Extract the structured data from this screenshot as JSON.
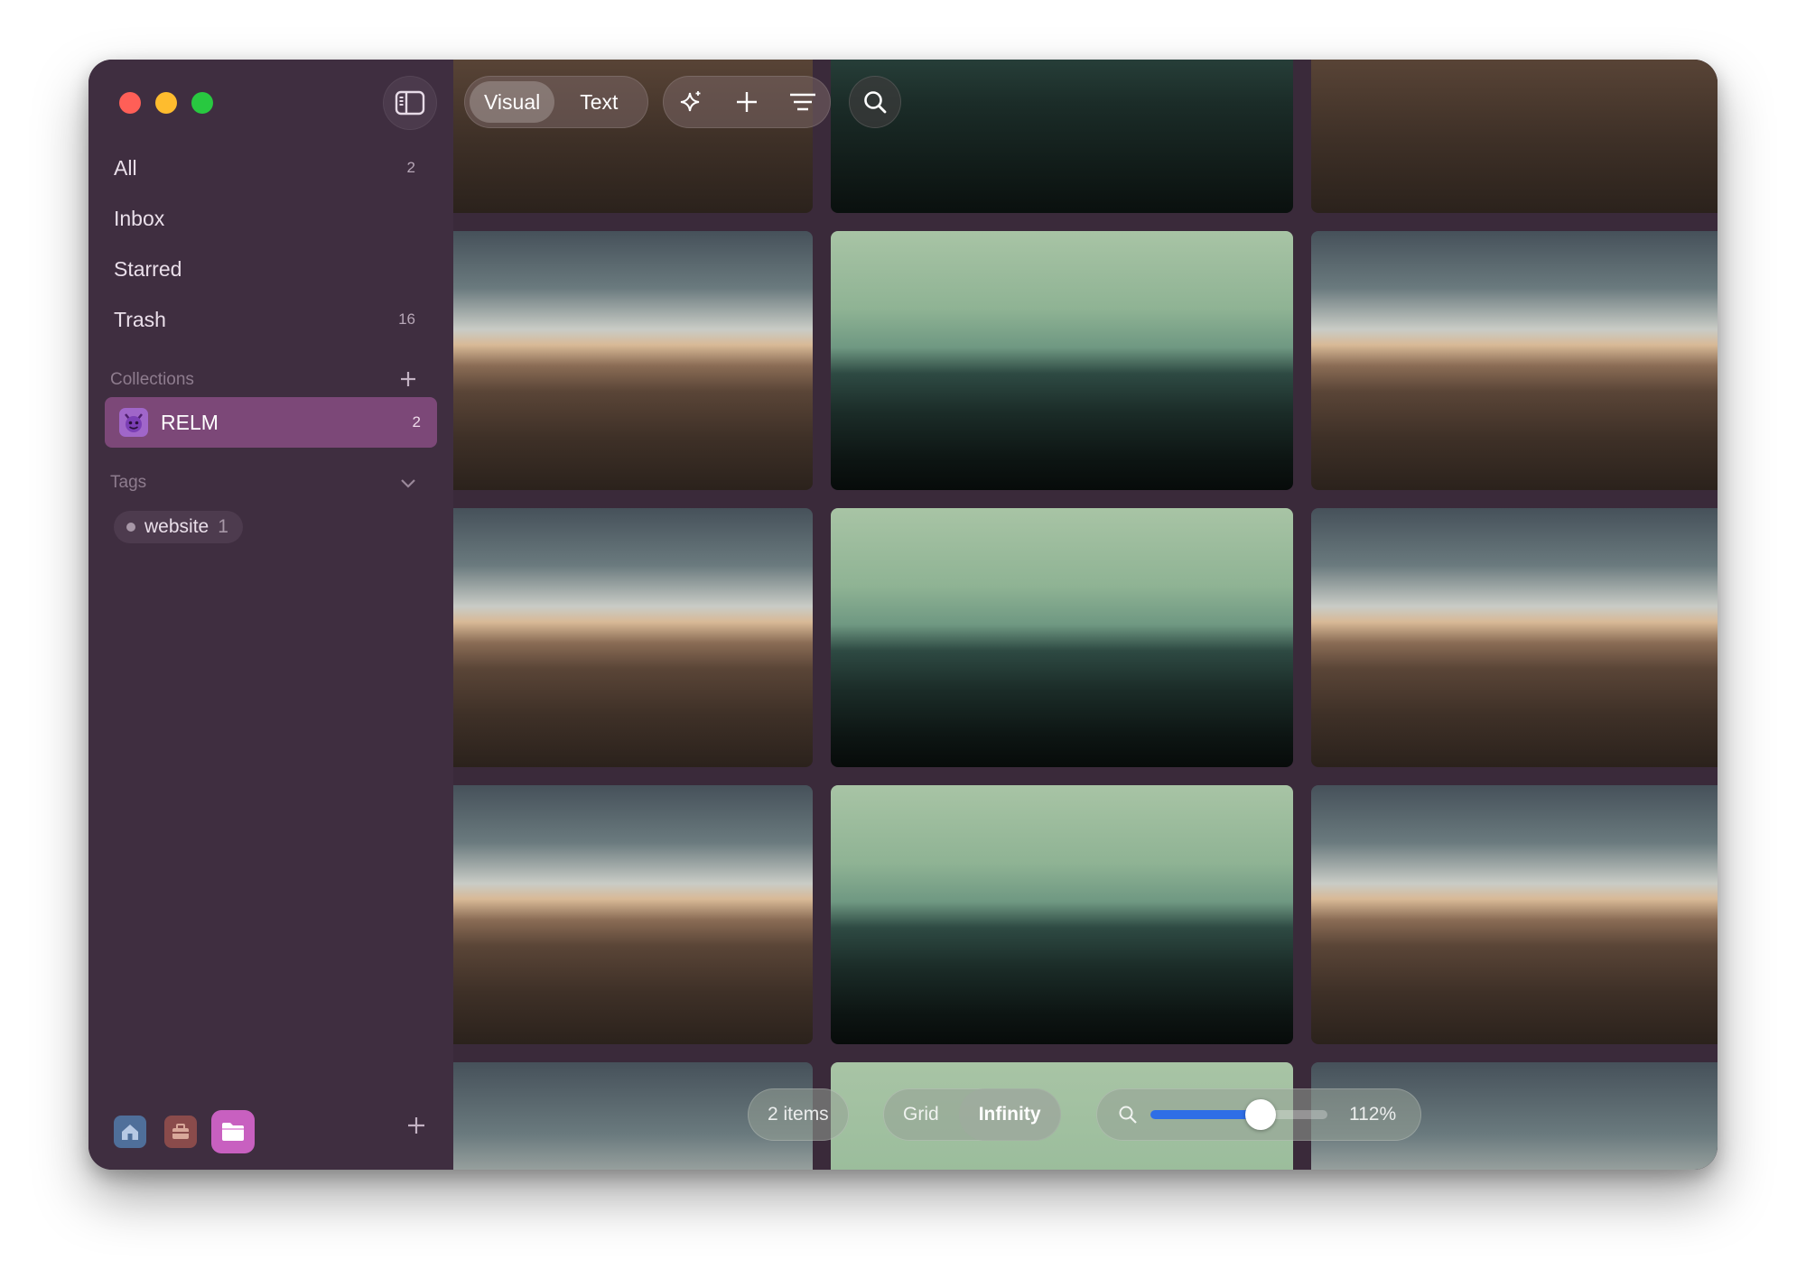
{
  "toolbar": {
    "view_modes": [
      "Visual",
      "Text"
    ],
    "active_view_mode": "Visual",
    "icons": [
      "sparkles-icon",
      "plus-icon",
      "filter-icon",
      "search-icon"
    ]
  },
  "sidebar": {
    "nav": [
      {
        "label": "All",
        "count": "2"
      },
      {
        "label": "Inbox",
        "count": ""
      },
      {
        "label": "Starred",
        "count": ""
      },
      {
        "label": "Trash",
        "count": "16"
      }
    ],
    "collections": {
      "label": "Collections",
      "items": [
        {
          "label": "RELM",
          "count": "2",
          "icon": "devil-emoji-icon",
          "selected": true
        }
      ]
    },
    "tags": {
      "label": "Tags",
      "items": [
        {
          "label": "website",
          "count": "1"
        }
      ]
    },
    "bottom_icons": [
      "home-icon",
      "toolbox-icon",
      "folder-icon"
    ]
  },
  "bottom_bar": {
    "items_count": "2 items",
    "layout_modes": [
      "Grid",
      "Infinity"
    ],
    "active_layout": "Infinity",
    "zoom_value": "112%",
    "zoom_fraction": 0.62
  },
  "colors": {
    "sidebar_bg": "#3f2e40",
    "collection_selected": "#7c4878",
    "close": "#ff5f57",
    "minimize": "#febc2e",
    "maximize": "#28c840",
    "slider_accent": "#2f6ee6"
  }
}
